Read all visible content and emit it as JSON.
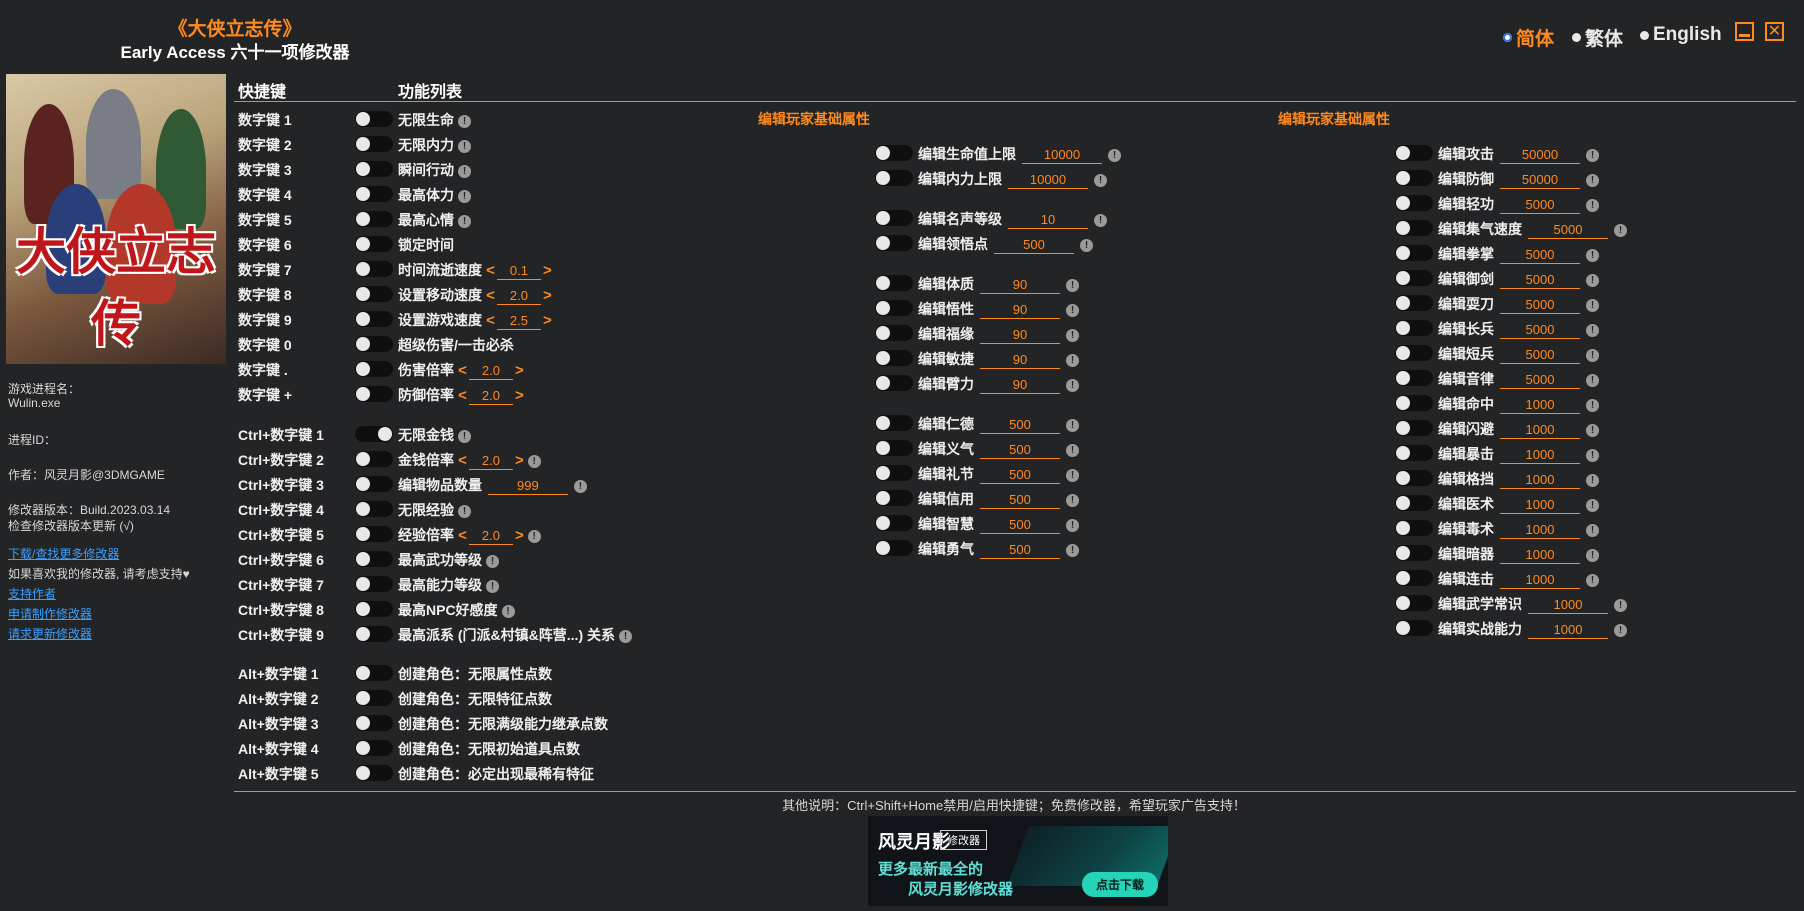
{
  "header": {
    "title": "《大侠立志传》",
    "subtitle": "Early Access 六十一项修改器"
  },
  "languages": [
    {
      "label": "简体",
      "selected": true,
      "color": "#ff8a1e"
    },
    {
      "label": "繁体",
      "selected": false
    },
    {
      "label": "English",
      "selected": false
    }
  ],
  "sidebar": {
    "process_label": "游戏进程名：",
    "process_value": "Wulin.exe",
    "pid_label": "进程ID：",
    "author": "作者：风灵月影@3DMGAME",
    "version": "修改器版本：Build.2023.03.14",
    "check_update": "检查修改器版本更新 (√)",
    "links": [
      "下载/查找更多修改器",
      "支持作者",
      "申请制作修改器",
      "请求更新修改器"
    ],
    "support_text": "如果喜欢我的修改器, 请考虑支持♥"
  },
  "columns": {
    "hotkey": "快捷键",
    "features": "功能列表"
  },
  "numeric_hotkeys": [
    {
      "key": "数字键 1",
      "label": "无限生命",
      "info": true
    },
    {
      "key": "数字键 2",
      "label": "无限内力",
      "info": true
    },
    {
      "key": "数字键 3",
      "label": "瞬间行动",
      "info": true
    },
    {
      "key": "数字键 4",
      "label": "最高体力",
      "info": true
    },
    {
      "key": "数字键 5",
      "label": "最高心情",
      "info": true
    },
    {
      "key": "数字键 6",
      "label": "锁定时间",
      "info": false
    },
    {
      "key": "数字键 7",
      "label": "时间流逝速度",
      "value": "0.1"
    },
    {
      "key": "数字键 8",
      "label": "设置移动速度",
      "value": "2.0"
    },
    {
      "key": "数字键 9",
      "label": "设置游戏速度",
      "value": "2.5"
    },
    {
      "key": "数字键 0",
      "label": "超级伤害/一击必杀",
      "info": false
    },
    {
      "key": "数字键 .",
      "label": "伤害倍率",
      "value": "2.0"
    },
    {
      "key": "数字键 +",
      "label": "防御倍率",
      "value": "2.0"
    }
  ],
  "ctrl_hotkeys": [
    {
      "key": "Ctrl+数字键 1",
      "label": "无限金钱",
      "info": true,
      "on": true
    },
    {
      "key": "Ctrl+数字键 2",
      "label": "金钱倍率",
      "value": "2.0",
      "info": true
    },
    {
      "key": "Ctrl+数字键 3",
      "label": "编辑物品数量",
      "edit": "999",
      "info": true
    },
    {
      "key": "Ctrl+数字键 4",
      "label": "无限经验",
      "info": true
    },
    {
      "key": "Ctrl+数字键 5",
      "label": "经验倍率",
      "value": "2.0",
      "info": true
    },
    {
      "key": "Ctrl+数字键 6",
      "label": "最高武功等级",
      "info": true
    },
    {
      "key": "Ctrl+数字键 7",
      "label": "最高能力等级",
      "info": true
    },
    {
      "key": "Ctrl+数字键 8",
      "label": "最高NPC好感度",
      "info": true
    },
    {
      "key": "Ctrl+数字键 9",
      "label": "最高派系 (门派&村镇&阵营...) 关系",
      "info": true
    }
  ],
  "alt_hotkeys": [
    {
      "key": "Alt+数字键 1",
      "label": "创建角色：无限属性点数"
    },
    {
      "key": "Alt+数字键 2",
      "label": "创建角色：无限特征点数"
    },
    {
      "key": "Alt+数字键 3",
      "label": "创建角色：无限满级能力继承点数"
    },
    {
      "key": "Alt+数字键 4",
      "label": "创建角色：无限初始道具点数"
    },
    {
      "key": "Alt+数字键 5",
      "label": "创建角色：必定出现最稀有特征"
    }
  ],
  "section_mid": {
    "title": "编辑玩家基础属性",
    "groups": [
      [
        {
          "label": "编辑生命值上限",
          "value": "10000"
        },
        {
          "label": "编辑内力上限",
          "value": "10000"
        }
      ],
      [
        {
          "label": "编辑名声等级",
          "value": "10"
        },
        {
          "label": "编辑领悟点",
          "value": "500"
        }
      ],
      [
        {
          "label": "编辑体质",
          "value": "90"
        },
        {
          "label": "编辑悟性",
          "value": "90"
        },
        {
          "label": "编辑福缘",
          "value": "90"
        },
        {
          "label": "编辑敏捷",
          "value": "90"
        },
        {
          "label": "编辑臂力",
          "value": "90"
        }
      ],
      [
        {
          "label": "编辑仁德",
          "value": "500"
        },
        {
          "label": "编辑义气",
          "value": "500"
        },
        {
          "label": "编辑礼节",
          "value": "500"
        },
        {
          "label": "编辑信用",
          "value": "500"
        },
        {
          "label": "编辑智慧",
          "value": "500"
        },
        {
          "label": "编辑勇气",
          "value": "500"
        }
      ]
    ]
  },
  "section_right": {
    "title": "编辑玩家基础属性",
    "items": [
      {
        "label": "编辑攻击",
        "value": "50000"
      },
      {
        "label": "编辑防御",
        "value": "50000"
      },
      {
        "label": "编辑轻功",
        "value": "5000"
      },
      {
        "label": "编辑集气速度",
        "value": "5000"
      },
      {
        "label": "编辑拳掌",
        "value": "5000"
      },
      {
        "label": "编辑御剑",
        "value": "5000"
      },
      {
        "label": "编辑耍刀",
        "value": "5000"
      },
      {
        "label": "编辑长兵",
        "value": "5000"
      },
      {
        "label": "编辑短兵",
        "value": "5000"
      },
      {
        "label": "编辑音律",
        "value": "5000"
      },
      {
        "label": "编辑命中",
        "value": "1000"
      },
      {
        "label": "编辑闪避",
        "value": "1000"
      },
      {
        "label": "编辑暴击",
        "value": "1000"
      },
      {
        "label": "编辑格挡",
        "value": "1000"
      },
      {
        "label": "编辑医术",
        "value": "1000"
      },
      {
        "label": "编辑毒术",
        "value": "1000"
      },
      {
        "label": "编辑暗器",
        "value": "1000"
      },
      {
        "label": "编辑连击",
        "value": "1000"
      },
      {
        "label": "编辑武学常识",
        "value": "1000"
      },
      {
        "label": "编辑实战能力",
        "value": "1000"
      }
    ]
  },
  "footer": {
    "note": "其他说明：Ctrl+Shift+Home禁用/启用快捷键；免费修改器，希望玩家广告支持！"
  },
  "ad": {
    "brand": "风灵月影",
    "badge": "修改器",
    "line1": "更多最新最全的",
    "line2": "风灵月影修改器",
    "button": "点击下载"
  },
  "colors": {
    "accent": "#ff8a1e",
    "background": "#232426",
    "link": "#3aa0ff"
  }
}
